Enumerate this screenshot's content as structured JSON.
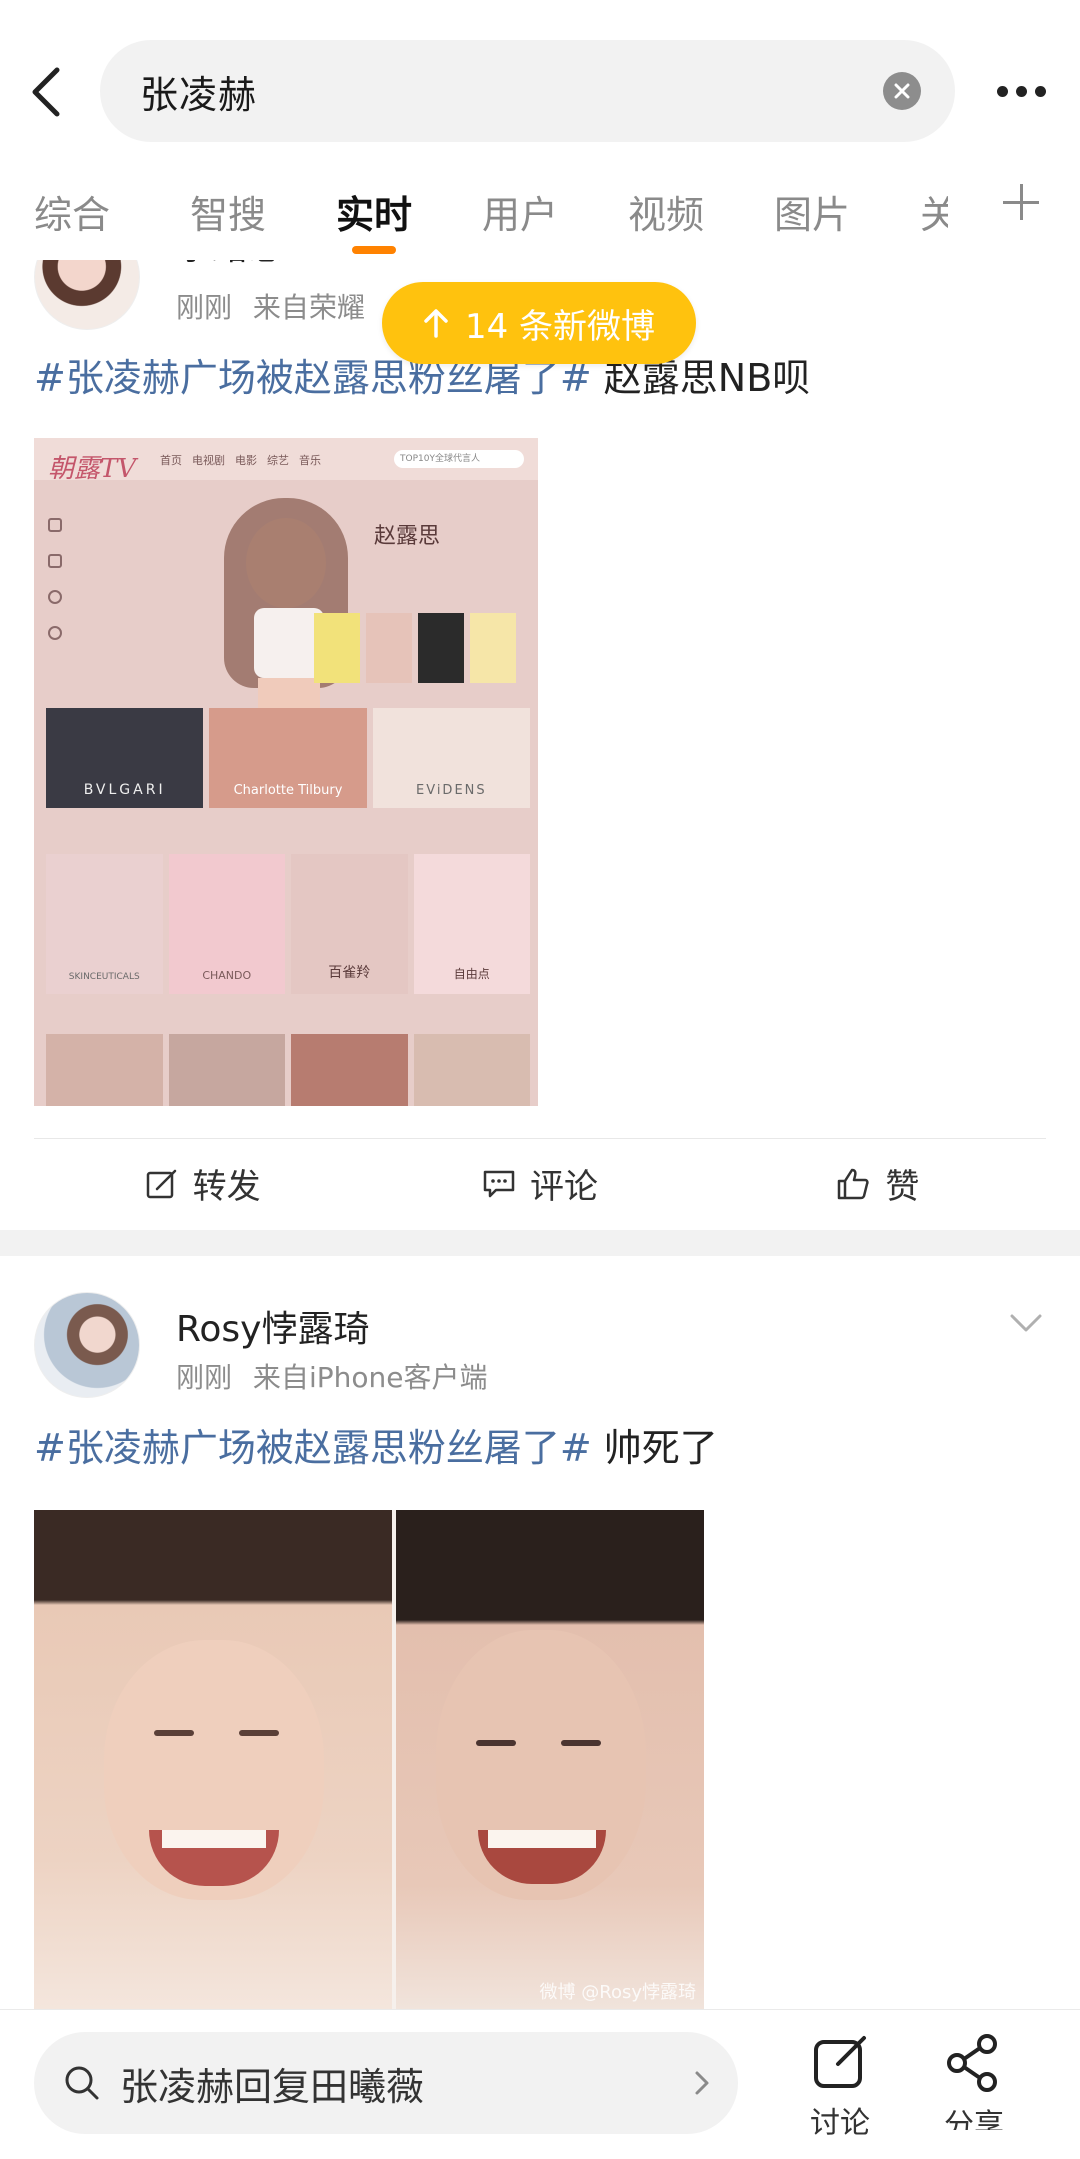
{
  "header": {
    "search_query": "张凌赫"
  },
  "tabs": [
    "综合",
    "智搜",
    "实时",
    "用户",
    "视频",
    "图片",
    "关"
  ],
  "active_tab": "实时",
  "new_posts_pill": "14 条新微博",
  "posts": [
    {
      "username": "李路思",
      "time": "刚刚",
      "source_prefix": "来自",
      "source": "荣耀",
      "topic": "#张凌赫广场被赵露思粉丝屠了#",
      "text": " 赵露思NB呗",
      "image": {
        "logo": "朝露TV",
        "nav": [
          "首页",
          "电视剧",
          "电影",
          "综艺",
          "音乐",
          "综艺"
        ],
        "search_hint": "TOP10Y全球代言人",
        "name": "赵露思",
        "brands": [
          "BVLGARI",
          "Charlotte Tilbury",
          "EViDENS"
        ],
        "beauty": [
          "SKINCEUTICALS",
          "CHANDO",
          "百雀羚",
          "自由点"
        ]
      },
      "actions": {
        "repost": "转发",
        "comment": "评论",
        "like": "赞"
      }
    },
    {
      "username": "Rosy悖露琦",
      "time": "刚刚",
      "source_prefix": "来自",
      "source": "iPhone客户端",
      "topic": "#张凌赫广场被赵露思粉丝屠了#",
      "text": " 帅死了",
      "image_watermark": "微博 @Rosy悖露琦"
    }
  ],
  "bottom_bar": {
    "search_suggestion": "张凌赫回复田曦薇",
    "discuss_label": "讨论",
    "share_label": "分享"
  },
  "colors": {
    "accent": "#ff8200",
    "topic": "#4a6ea0",
    "pill": "#ffc20e"
  }
}
